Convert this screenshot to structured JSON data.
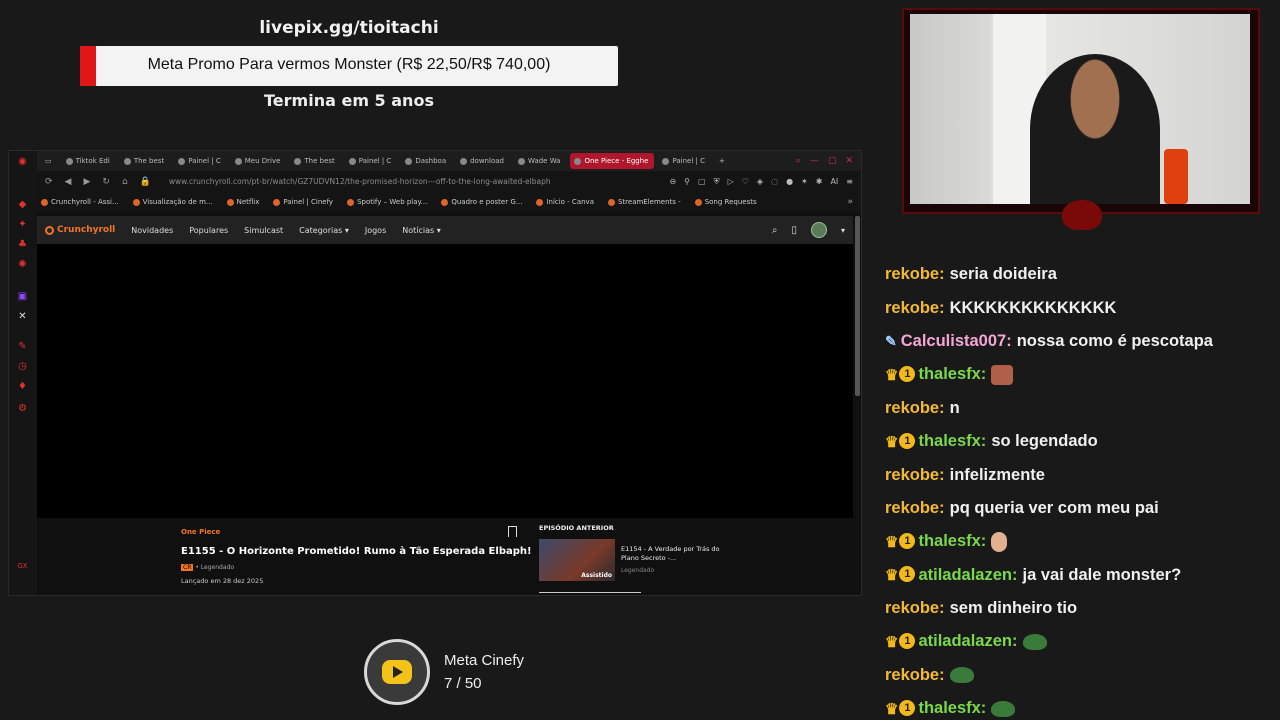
{
  "overlay": {
    "livepix": "livepix.gg/tioitachi",
    "goal_text": "Meta Promo Para vermos Monster (R$ 22,50/R$ 740,00)",
    "goal_progress": 0.03,
    "ends": "Termina em 5 anos",
    "goal_color": "#e01717"
  },
  "browser": {
    "tabs": [
      {
        "label": "Tiktok Edi"
      },
      {
        "label": "The best"
      },
      {
        "label": "Painel | C"
      },
      {
        "label": "Meu Drive"
      },
      {
        "label": "The best"
      },
      {
        "label": "Painel | C"
      },
      {
        "label": "Dashboa"
      },
      {
        "label": "download"
      },
      {
        "label": "Wade Wa"
      },
      {
        "label": "One Piece - Egghe",
        "active": true
      },
      {
        "label": "Painel | C"
      }
    ],
    "url": "www.crunchyroll.com/pt-br/watch/GZ7UDVN12/the-promised-horizon---off-to-the-long-awaited-elbaph",
    "bookmarks": [
      "Crunchyroll - Assi...",
      "Visualização de m...",
      "Netflix",
      "Painel | Cinefy",
      "Spotify – Web play...",
      "Quadro e poster G...",
      "Início - Canva",
      "StreamElements -",
      "Song Requests"
    ]
  },
  "crunchyroll": {
    "logo": "Crunchyroll",
    "nav": [
      "Novidades",
      "Populares",
      "Simulcast",
      "Categorias",
      "Jogos",
      "Notícias"
    ],
    "series": "One Piece",
    "episode_title": "E1155 - O Horizonte Prometido! Rumo à Tão Esperada Elbaph!",
    "subtitle": "Legendado",
    "release": "Lançado em 28 dez 2025",
    "prev_label": "EPISÓDIO ANTERIOR",
    "prev_title": "E1154 - A Verdade por Trás do Plano Secreto -...",
    "prev_sub": "Legendado",
    "prev_badge": "Assistido",
    "accent": "#f47521"
  },
  "meta": {
    "title": "Meta Cinefy",
    "count": "7 / 50"
  },
  "chat": [
    {
      "user": "rekobe:",
      "color": "#f2b938",
      "text": "seria doideira"
    },
    {
      "user": "rekobe:",
      "color": "#f2b938",
      "text": "KKKKKKKKKKKKKK"
    },
    {
      "user": "Calculista007:",
      "color": "#f4a6d7",
      "text": "nossa como é pescotapa",
      "badge": "pen"
    },
    {
      "user": "thalesfx:",
      "color": "#7bd84a",
      "text": "",
      "badge": "sub",
      "emote": "face"
    },
    {
      "user": "rekobe:",
      "color": "#f2b938",
      "text": "n"
    },
    {
      "user": "thalesfx:",
      "color": "#7bd84a",
      "text": "so legendado",
      "badge": "sub"
    },
    {
      "user": "rekobe:",
      "color": "#f2b938",
      "text": "infelizmente"
    },
    {
      "user": "rekobe:",
      "color": "#f2b938",
      "text": "pq queria ver com meu pai"
    },
    {
      "user": "thalesfx:",
      "color": "#7bd84a",
      "text": "",
      "badge": "sub",
      "emote": "hand"
    },
    {
      "user": "atiladalazen:",
      "color": "#7bd84a",
      "text": "ja vai dale monster?",
      "badge": "sub"
    },
    {
      "user": "rekobe:",
      "color": "#f2b938",
      "text": "sem dinheiro tio"
    },
    {
      "user": "atiladalazen:",
      "color": "#7bd84a",
      "text": "",
      "badge": "sub",
      "emote": "pepe"
    },
    {
      "user": "rekobe:",
      "color": "#f2b938",
      "text": "",
      "emote": "pepe"
    },
    {
      "user": "thalesfx:",
      "color": "#7bd84a",
      "text": "",
      "badge": "sub",
      "emote": "pepe"
    }
  ]
}
